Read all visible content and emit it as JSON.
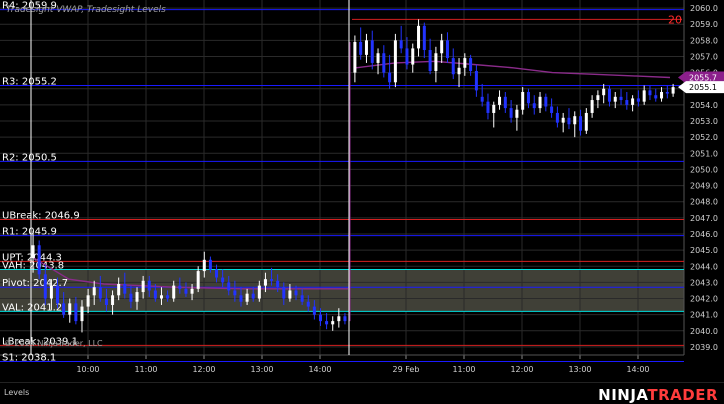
{
  "indicator_title": "Tradesight VWAP, Tradesight Levels",
  "copyright": "© 2024 NinjaTrader, LLC",
  "footer": {
    "tab_label": "Levels",
    "brand_left": "NINJA",
    "brand_right": "TRADER"
  },
  "colors": {
    "background": "#000000",
    "grid": "#2a2a2a",
    "candle_up": "#ffffff",
    "candle_down": "#2233ff",
    "vwap": "#8a2b8a",
    "level_blue": "#1a1aff",
    "level_red": "#d42020",
    "level_cyan": "#00dede",
    "value_area_fill": "#55554a",
    "price_marker": "#ffffff",
    "vwap_marker": "#8b1f8b",
    "top_label": "#ff2a2a"
  },
  "chart_data": {
    "type": "candlestick",
    "ylim": [
      2038.5,
      2060.5
    ],
    "y_ticks": [
      "2039.0",
      "2040.0",
      "2041.0",
      "2042.0",
      "2043.0",
      "2044.0",
      "2045.0",
      "2046.0",
      "2047.0",
      "2048.0",
      "2049.0",
      "2050.0",
      "2051.0",
      "2052.0",
      "2053.0",
      "2054.0",
      "2055.0",
      "2056.0",
      "2057.0",
      "2058.0",
      "2059.0",
      "2060.0"
    ],
    "x_ticks": [
      "10:00",
      "11:00",
      "12:00",
      "13:00",
      "14:00",
      "29 Feb",
      "11:00",
      "12:00",
      "13:00",
      "14:00"
    ],
    "session_break_label": "29 Feb",
    "levels": [
      {
        "label": "R4: 2059.9",
        "value": 2059.9,
        "kind": "blue"
      },
      {
        "label": "R3: 2055.2",
        "value": 2055.2,
        "kind": "blue"
      },
      {
        "label": "R2: 2050.5",
        "value": 2050.5,
        "kind": "blue"
      },
      {
        "label": "UBreak: 2046.9",
        "value": 2046.9,
        "kind": "red"
      },
      {
        "label": "R1: 2045.9",
        "value": 2045.9,
        "kind": "blue"
      },
      {
        "label": "UPT: 2044.3",
        "value": 2044.3,
        "kind": "red"
      },
      {
        "label": "VAH: 2043.8",
        "value": 2043.8,
        "kind": "cyan"
      },
      {
        "label": "Pivot: 2042.7",
        "value": 2042.7,
        "kind": "blue"
      },
      {
        "label": "VAL: 2041.2",
        "value": 2041.2,
        "kind": "cyan"
      },
      {
        "label": "LBreak: 2039.1",
        "value": 2039.1,
        "kind": "red"
      },
      {
        "label": "S1: 2038.1",
        "value": 2038.1,
        "kind": "blue"
      }
    ],
    "value_area": [
      2041.2,
      2043.8
    ],
    "top_red_level": {
      "value": 2059.3,
      "label": "20"
    },
    "last_price": {
      "value": 2055.1,
      "label": "2055.1"
    },
    "vwap_marker": {
      "value": 2055.7,
      "label": "2055.7"
    },
    "session1_candles": [
      [
        2044.5,
        2046.2,
        2043.6,
        2045.3
      ],
      [
        2045.3,
        2045.6,
        2043.2,
        2043.5
      ],
      [
        2043.5,
        2044.1,
        2041.6,
        2042.0
      ],
      [
        2042.0,
        2043.2,
        2041.3,
        2042.8
      ],
      [
        2042.8,
        2043.3,
        2041.4,
        2041.7
      ],
      [
        2041.7,
        2042.4,
        2040.8,
        2041.0
      ],
      [
        2041.0,
        2042.0,
        2040.5,
        2041.7
      ],
      [
        2041.7,
        2042.1,
        2040.4,
        2040.6
      ],
      [
        2040.6,
        2041.9,
        2039.9,
        2041.5
      ],
      [
        2041.5,
        2042.6,
        2041.1,
        2042.2
      ],
      [
        2042.2,
        2043.1,
        2041.6,
        2042.7
      ],
      [
        2042.7,
        2043.4,
        2041.8,
        2042.0
      ],
      [
        2042.0,
        2042.6,
        2041.2,
        2041.6
      ],
      [
        2041.6,
        2042.5,
        2041.0,
        2042.2
      ],
      [
        2042.2,
        2043.3,
        2041.9,
        2042.9
      ],
      [
        2042.9,
        2043.6,
        2042.0,
        2042.3
      ],
      [
        2042.3,
        2042.8,
        2041.4,
        2041.8
      ],
      [
        2041.8,
        2042.7,
        2041.3,
        2042.4
      ],
      [
        2042.4,
        2043.4,
        2042.0,
        2043.1
      ],
      [
        2043.1,
        2043.4,
        2042.1,
        2042.5
      ],
      [
        2042.5,
        2042.9,
        2041.8,
        2042.0
      ],
      [
        2042.0,
        2042.7,
        2041.6,
        2042.2
      ],
      [
        2042.2,
        2042.5,
        2041.8,
        2042.0
      ],
      [
        2042.0,
        2043.1,
        2041.8,
        2042.8
      ],
      [
        2042.8,
        2043.3,
        2042.3,
        2042.6
      ],
      [
        2042.6,
        2043.0,
        2042.1,
        2042.3
      ],
      [
        2042.3,
        2042.9,
        2041.9,
        2042.6
      ],
      [
        2042.6,
        2044.0,
        2042.4,
        2043.7
      ],
      [
        2043.7,
        2044.9,
        2043.3,
        2044.4
      ],
      [
        2044.4,
        2044.6,
        2043.6,
        2043.8
      ],
      [
        2043.8,
        2044.1,
        2043.0,
        2043.3
      ],
      [
        2043.3,
        2043.8,
        2042.7,
        2043.0
      ],
      [
        2043.0,
        2043.4,
        2042.2,
        2042.5
      ],
      [
        2042.5,
        2043.1,
        2041.8,
        2042.2
      ],
      [
        2042.2,
        2042.7,
        2041.5,
        2041.8
      ],
      [
        2041.8,
        2042.6,
        2041.6,
        2042.3
      ],
      [
        2042.3,
        2042.7,
        2041.8,
        2042.0
      ],
      [
        2042.0,
        2043.1,
        2041.8,
        2042.8
      ],
      [
        2042.8,
        2043.6,
        2042.4,
        2043.2
      ],
      [
        2043.2,
        2043.9,
        2042.8,
        2043.1
      ],
      [
        2043.1,
        2043.5,
        2042.4,
        2042.7
      ],
      [
        2042.7,
        2043.0,
        2041.6,
        2042.0
      ],
      [
        2042.0,
        2042.9,
        2041.8,
        2042.5
      ],
      [
        2042.5,
        2042.8,
        2041.9,
        2042.2
      ],
      [
        2042.2,
        2042.6,
        2041.6,
        2041.8
      ],
      [
        2041.8,
        2042.2,
        2041.2,
        2041.5
      ],
      [
        2041.5,
        2041.9,
        2040.7,
        2041.0
      ],
      [
        2041.0,
        2041.4,
        2040.3,
        2040.6
      ],
      [
        2040.6,
        2041.1,
        2040.1,
        2040.4
      ],
      [
        2040.4,
        2040.9,
        2040.0,
        2040.6
      ],
      [
        2040.6,
        2041.4,
        2040.2,
        2040.9
      ],
      [
        2040.9,
        2041.1,
        2040.4,
        2040.6
      ]
    ],
    "session2_candles": [
      [
        2056.0,
        2058.3,
        2055.4,
        2057.9
      ],
      [
        2057.9,
        2058.8,
        2056.8,
        2057.1
      ],
      [
        2057.1,
        2058.4,
        2056.6,
        2058.0
      ],
      [
        2058.0,
        2058.6,
        2056.2,
        2056.6
      ],
      [
        2056.6,
        2057.5,
        2055.9,
        2057.2
      ],
      [
        2057.2,
        2057.7,
        2055.7,
        2056.0
      ],
      [
        2056.0,
        2057.1,
        2055.0,
        2055.4
      ],
      [
        2055.4,
        2058.4,
        2055.1,
        2058.0
      ],
      [
        2058.0,
        2058.9,
        2057.2,
        2057.5
      ],
      [
        2057.5,
        2058.2,
        2056.2,
        2056.5
      ],
      [
        2056.5,
        2057.8,
        2056.0,
        2057.5
      ],
      [
        2057.5,
        2059.3,
        2057.0,
        2058.9
      ],
      [
        2058.9,
        2059.1,
        2056.9,
        2057.4
      ],
      [
        2057.4,
        2058.1,
        2055.9,
        2056.1
      ],
      [
        2056.1,
        2057.6,
        2055.4,
        2057.2
      ],
      [
        2057.2,
        2058.4,
        2056.6,
        2058.0
      ],
      [
        2058.0,
        2058.5,
        2056.6,
        2056.9
      ],
      [
        2056.9,
        2057.5,
        2055.6,
        2055.9
      ],
      [
        2055.9,
        2056.9,
        2055.1,
        2056.3
      ],
      [
        2056.3,
        2057.2,
        2055.8,
        2056.9
      ],
      [
        2056.9,
        2057.1,
        2055.8,
        2056.1
      ],
      [
        2056.1,
        2056.5,
        2054.5,
        2054.9
      ],
      [
        2054.5,
        2055.3,
        2053.9,
        2054.2
      ],
      [
        2054.2,
        2054.7,
        2053.1,
        2053.5
      ],
      [
        2053.5,
        2054.2,
        2052.6,
        2054.0
      ],
      [
        2054.0,
        2054.9,
        2053.7,
        2054.5
      ],
      [
        2054.5,
        2054.8,
        2053.5,
        2053.8
      ],
      [
        2053.8,
        2054.3,
        2052.9,
        2053.2
      ],
      [
        2053.2,
        2054.0,
        2052.4,
        2053.7
      ],
      [
        2053.7,
        2055.1,
        2053.4,
        2054.8
      ],
      [
        2054.8,
        2055.0,
        2053.8,
        2054.1
      ],
      [
        2054.1,
        2054.6,
        2053.4,
        2053.8
      ],
      [
        2053.8,
        2054.8,
        2053.5,
        2054.5
      ],
      [
        2054.5,
        2054.7,
        2053.6,
        2053.9
      ],
      [
        2053.9,
        2054.4,
        2053.2,
        2053.5
      ],
      [
        2053.5,
        2053.9,
        2052.6,
        2052.9
      ],
      [
        2052.9,
        2053.5,
        2052.3,
        2053.2
      ],
      [
        2053.2,
        2053.8,
        2052.5,
        2052.8
      ],
      [
        2052.8,
        2053.6,
        2052.0,
        2053.3
      ],
      [
        2053.3,
        2053.7,
        2052.1,
        2052.4
      ],
      [
        2052.4,
        2053.8,
        2052.2,
        2053.5
      ],
      [
        2053.5,
        2054.6,
        2053.2,
        2054.3
      ],
      [
        2054.3,
        2054.9,
        2053.8,
        2054.6
      ],
      [
        2054.6,
        2055.3,
        2054.1,
        2055.0
      ],
      [
        2055.0,
        2055.2,
        2053.9,
        2054.2
      ],
      [
        2054.2,
        2054.8,
        2053.8,
        2054.5
      ],
      [
        2054.5,
        2055.0,
        2054.0,
        2054.3
      ],
      [
        2054.3,
        2054.8,
        2053.7,
        2054.0
      ],
      [
        2054.0,
        2054.6,
        2053.6,
        2054.4
      ],
      [
        2054.4,
        2054.9,
        2053.9,
        2054.2
      ],
      [
        2054.2,
        2055.2,
        2054.0,
        2054.9
      ],
      [
        2054.9,
        2055.2,
        2054.3,
        2054.6
      ],
      [
        2054.6,
        2055.0,
        2054.2,
        2054.4
      ],
      [
        2054.4,
        2055.1,
        2054.2,
        2054.8
      ],
      [
        2054.8,
        2055.2,
        2054.4,
        2054.7
      ],
      [
        2054.7,
        2055.3,
        2054.5,
        2055.1
      ]
    ],
    "vwap_session1": [
      2044.5,
      2043.2,
      2042.9,
      2042.8,
      2042.7,
      2042.65,
      2042.6,
      2042.6,
      2042.6,
      2042.6
    ],
    "vwap_session2": [
      2056.3,
      2056.6,
      2056.7,
      2056.5,
      2056.3,
      2056.0,
      2055.9,
      2055.8,
      2055.7
    ]
  }
}
